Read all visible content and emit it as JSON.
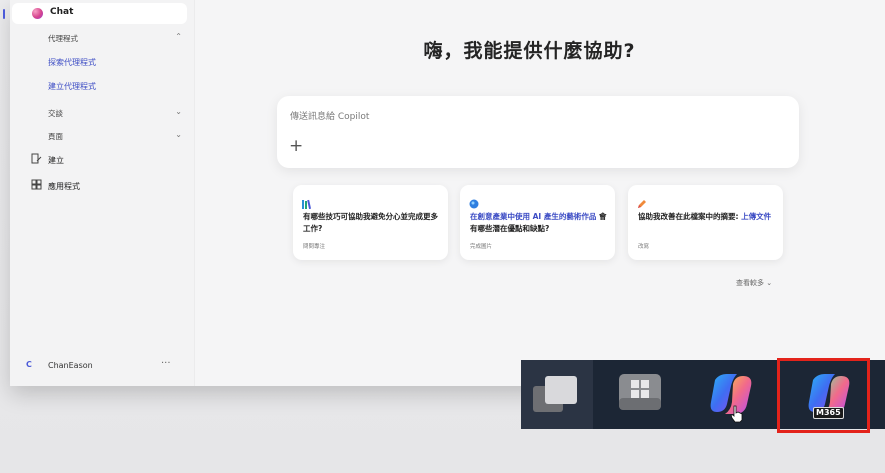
{
  "sidebar": {
    "chat_label": "Chat",
    "agents_header": "代理程式",
    "explore_agents": "探索代理程式",
    "create_agent": "建立代理程式",
    "conversations": "交談",
    "pages": "頁面",
    "create": "建立",
    "apps": "應用程式",
    "user_initial": "C",
    "user_name": "ChanEason",
    "more": "···"
  },
  "main": {
    "greeting": "嗨，我能提供什麼協助?",
    "composer_placeholder": "傳送訊息給 Copilot",
    "plus": "+",
    "cards": [
      {
        "icon": "books-icon",
        "text": "有哪些技巧可協助我避免分心並完成更多工作?",
        "tag": "問問專注"
      },
      {
        "icon": "globe-icon",
        "text_highlight": "在創意產業中使用 AI 產生的藝術作品",
        "text_rest": " 會有哪些潛在優點和缺點?",
        "tag": "完成圖片"
      },
      {
        "icon": "pencil-icon",
        "text_main": "協助我改善在此檔案中的摘要: ",
        "text_link": "上傳文件",
        "tag": "改寫"
      }
    ],
    "see_more": "查看較多 ⌄"
  },
  "taskbar": {
    "items": [
      "task-view-icon",
      "start-icon",
      "copilot-icon",
      "m365-copilot-icon"
    ],
    "m365_label": "M365"
  },
  "colors": {
    "accent": "#3b4bc4",
    "highlight_frame": "#e3231b",
    "taskbar_bg": "#1c2635"
  }
}
